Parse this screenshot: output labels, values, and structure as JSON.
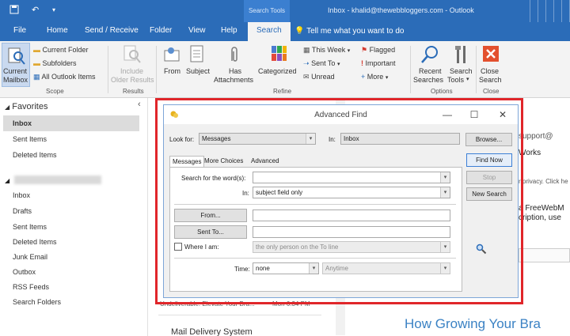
{
  "titlebar": {
    "context_tab": "Search Tools",
    "window_title": "Inbox - khalid@thewebbloggers.com - Outlook"
  },
  "tabs": [
    "File",
    "Home",
    "Send / Receive",
    "Folder",
    "View",
    "Help",
    "Search"
  ],
  "tell_me": "Tell me what you want to do",
  "ribbon": {
    "scope": {
      "current_mailbox_line1": "Current",
      "current_mailbox_line2": "Mailbox",
      "current_folder": "Current Folder",
      "subfolders": "Subfolders",
      "all_outlook_items": "All Outlook Items",
      "label": "Scope"
    },
    "results": {
      "include_line1": "Include",
      "include_line2": "Older Results",
      "label": "Results"
    },
    "refine": {
      "from": "From",
      "subject": "Subject",
      "has_line1": "Has",
      "has_line2": "Attachments",
      "categorized": "Categorized",
      "this_week": "This Week",
      "sent_to": "Sent To",
      "unread": "Unread",
      "flagged": "Flagged",
      "important": "Important",
      "more": "More",
      "label": "Refine"
    },
    "options": {
      "recent_line1": "Recent",
      "recent_line2": "Searches",
      "search_tools_line1": "Search",
      "search_tools_line2": "Tools",
      "label": "Options"
    },
    "close": {
      "line1": "Close",
      "line2": "Search",
      "label": "Close"
    }
  },
  "nav": {
    "favorites": "Favorites",
    "fav_items": [
      "Inbox",
      "Sent Items",
      "Deleted Items"
    ],
    "account_items": [
      "Inbox",
      "Drafts",
      "Sent Items",
      "Deleted Items",
      "Junk Email",
      "Outbox",
      "RSS Feeds",
      "Search Folders"
    ]
  },
  "reading": {
    "support": "support@",
    "works": "Works",
    "privacy": "r privacy. Click he",
    "free1": "a FreeWebM",
    "free2": "cription, use",
    "heading": "How Growing Your Bra"
  },
  "message_list": {
    "undeliverable": "Undeliverable: Elevate Your Bra...",
    "time": "Mon 6:34 PM",
    "sender": "Mail Delivery System"
  },
  "dialog": {
    "title": "Advanced Find",
    "look_for_label": "Look for:",
    "look_for_value": "Messages",
    "in_label": "In:",
    "in_value": "Inbox",
    "browse": "Browse...",
    "tabs": [
      "Messages",
      "More Choices",
      "Advanced"
    ],
    "search_words_label": "Search for the word(s):",
    "search_words_value": "",
    "in2_label": "In:",
    "in2_value": "subject field only",
    "from_btn": "From...",
    "sent_to_btn": "Sent To...",
    "where_label": "Where I am:",
    "where_value": "the only person on the To line",
    "time_label": "Time:",
    "time_value": "none",
    "time_range": "Anytime",
    "find_now": "Find Now",
    "stop": "Stop",
    "new_search": "New Search"
  },
  "colors": {
    "accent": "#2b6cb8",
    "highlight": "#e0262a"
  }
}
